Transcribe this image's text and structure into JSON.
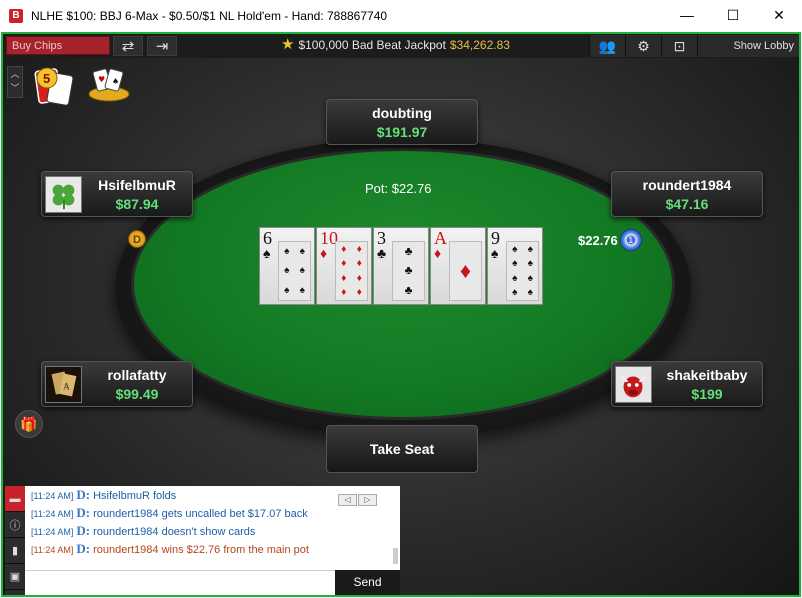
{
  "window": {
    "logo": "B",
    "title": "NLHE $100: BBJ 6-Max - $0.50/$1 NL Hold'em - Hand: 788867740",
    "minimize": "—",
    "maximize": "☐",
    "close": "✕"
  },
  "toolbar": {
    "buy_chips": "Buy Chips",
    "rebuy_icon": "⇄",
    "leave_icon": "⇥",
    "jackpot_label": "$100,000 Bad Beat Jackpot",
    "jackpot_value": "$34,262.83",
    "players_icon": "👥",
    "settings_icon": "⚙",
    "view_icon": "⊡",
    "show_lobby": "Show Lobby"
  },
  "table": {
    "pot": "Pot: $22.76",
    "board": [
      {
        "rank": "6",
        "suit": "♠",
        "color": "black"
      },
      {
        "rank": "10",
        "suit": "♦",
        "color": "red"
      },
      {
        "rank": "3",
        "suit": "♣",
        "color": "black"
      },
      {
        "rank": "A",
        "suit": "♦",
        "color": "red"
      },
      {
        "rank": "9",
        "suit": "♠",
        "color": "black"
      }
    ],
    "dealer_button": "D",
    "bet_amount": "$22.76",
    "bet_chip": "1",
    "take_seat": "Take Seat"
  },
  "seats": {
    "top": {
      "name": "doubting",
      "stack": "$191.97"
    },
    "left_top": {
      "name": "HsifelbmuR",
      "stack": "$87.94"
    },
    "right_top": {
      "name": "roundert1984",
      "stack": "$47.16"
    },
    "left_bottom": {
      "name": "rollafatty",
      "stack": "$99.49"
    },
    "right_bottom": {
      "name": "shakeitbaby",
      "stack": "$199"
    }
  },
  "chat": {
    "lines": [
      {
        "time": "[11:24 AM]",
        "marker": "D:",
        "text": "HsifelbmuR  folds",
        "color": "blue"
      },
      {
        "time": "[11:24 AM]",
        "marker": "D:",
        "text": "roundert1984  gets uncalled bet $17.07 back",
        "color": "blue"
      },
      {
        "time": "[11:24 AM]",
        "marker": "D:",
        "text": "roundert1984  doesn't show cards",
        "color": "blue"
      },
      {
        "time": "[11:24 AM]",
        "marker": "D:",
        "text": "roundert1984  wins $22.76 from the main pot",
        "color": "orange"
      }
    ],
    "send": "Send"
  }
}
